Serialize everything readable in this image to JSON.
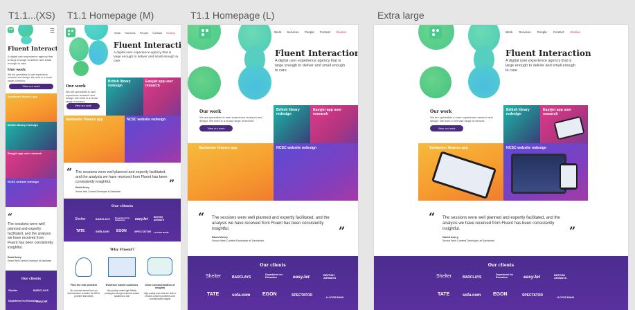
{
  "frames": [
    {
      "label": "T1.1...(XS)"
    },
    {
      "label": "T1.1 Homepage (M)"
    },
    {
      "label": "T1.1 Homepage (L)"
    },
    {
      "label": "Extra large"
    }
  ],
  "site": {
    "nav": [
      "Work",
      "Services",
      "People",
      "Contact",
      "Studios"
    ],
    "title": "Fluent Interaction",
    "subtitle": "A digital user experience agency that is large enough to deliver and small enough to care",
    "our_work": {
      "heading": "Our work",
      "text": "We are specialists in user experience research and design. We work in a broad range of sectors.",
      "button": "View our work"
    },
    "tiles": {
      "british_library": "British library redesign",
      "easyjet": "Easyjet app user research",
      "santander": "Santander finance app",
      "ncsc": "NCSC website redesign"
    },
    "quote": {
      "text": "The sessions were well planned and expertly facilitated, and the analysis we have received from Fluent has been consistently insightful.",
      "author": "David Avery",
      "role": "Senior Web Content Developer at Santander"
    },
    "clients": {
      "heading": "Our clients",
      "logos": [
        "Shelter",
        "BARCLAYS",
        "Department for Education",
        "easyJet",
        "BRITISH AIRWAYS",
        "TATE",
        "sofa.com",
        "EGON",
        "SPECTATOR",
        "LLOYDS BANK"
      ]
    },
    "why": {
      "heading": "Why Fluent?",
      "items": [
        {
          "title": "Find the real problem",
          "text": "Our success stems from our determination to define the REAL problem that needs"
        },
        {
          "title": "Evidence based solutions",
          "text": "We quickly create high-fidelity prototypes through evidence-based solutions to test"
        },
        {
          "title": "Clear communication of insights",
          "text": "High quality team that are able to resolve complex problems and communicate insights"
        }
      ]
    }
  },
  "colors": {
    "brand_green": "#4bc98b",
    "brand_purple": "#4a2a7d",
    "active_nav": "#d2386c"
  }
}
